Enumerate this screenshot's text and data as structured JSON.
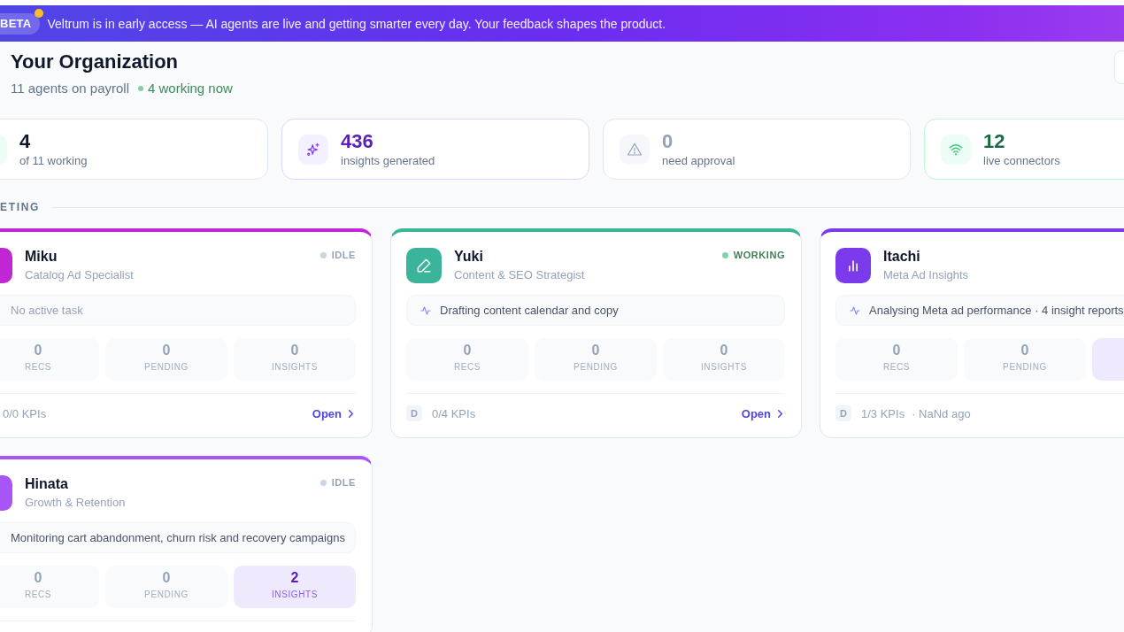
{
  "banner": {
    "badge": "BETA",
    "message": "Veltrum is in early access — AI agents are live and getting smarter every day. Your feedback shapes the product."
  },
  "header": {
    "title": "Your Organization",
    "agent_count": "11 agents on payroll",
    "working_now": "4 working now"
  },
  "stats": [
    {
      "kind": "working",
      "value": "4",
      "label": "of 11 working"
    },
    {
      "kind": "insights",
      "value": "436",
      "label": "insights generated"
    },
    {
      "kind": "approval",
      "value": "0",
      "label": "need approval"
    },
    {
      "kind": "connectors",
      "value": "12",
      "label": "live connectors"
    }
  ],
  "section": {
    "title": "ETING",
    "agents": [
      {
        "name": "Miku",
        "role": "Catalog Ad Specialist",
        "color": "#c026d3",
        "avatar": {
          "kind": "blank"
        },
        "status": {
          "label": "IDLE",
          "working": false
        },
        "task": {
          "kind": "empty",
          "text": "No active task"
        },
        "metrics": [
          {
            "value": "0",
            "label": "RECS",
            "highlighted": false
          },
          {
            "value": "0",
            "label": "PENDING",
            "highlighted": false
          },
          {
            "value": "0",
            "label": "INSIGHTS",
            "highlighted": false
          }
        ],
        "footer": {
          "kpis": "0/0 KPIs",
          "open": "Open"
        }
      },
      {
        "name": "Yuki",
        "role": "Content & SEO Strategist",
        "color": "#3bb49c",
        "avatar": {
          "kind": "pencil"
        },
        "status": {
          "label": "WORKING",
          "working": true
        },
        "task": {
          "kind": "activity",
          "text": "Drafting content calendar and copy"
        },
        "metrics": [
          {
            "value": "0",
            "label": "RECS",
            "highlighted": false
          },
          {
            "value": "0",
            "label": "PENDING",
            "highlighted": false
          },
          {
            "value": "0",
            "label": "INSIGHTS",
            "highlighted": false
          }
        ],
        "footer": {
          "initial": "D",
          "kpis": "0/4 KPIs",
          "open": "Open"
        }
      },
      {
        "name": "Itachi",
        "role": "Meta Ad Insights",
        "color": "#7c3aed",
        "avatar": {
          "kind": "bars"
        },
        "task": {
          "kind": "activity",
          "text": "Analysing Meta ad performance · 4 insight reports"
        },
        "metrics": [
          {
            "value": "0",
            "label": "RECS",
            "highlighted": false
          },
          {
            "value": "0",
            "label": "PENDING",
            "highlighted": false
          },
          {
            "highlighted": true
          }
        ],
        "footer": {
          "initial": "D",
          "kpis": "1/3 KPIs",
          "updated": "· NaNd ago"
        }
      },
      {
        "name": "Hinata",
        "role": "Growth & Retention",
        "color": "#a855f7",
        "avatar": {
          "kind": "blank"
        },
        "status": {
          "label": "IDLE",
          "working": false
        },
        "task": {
          "kind": "note",
          "text": "Monitoring cart abandonment, churn risk and recovery campaigns"
        },
        "metrics": [
          {
            "value": "0",
            "label": "RECS",
            "highlighted": false
          },
          {
            "value": "0",
            "label": "PENDING",
            "highlighted": false
          },
          {
            "value": "2",
            "label": "INSIGHTS",
            "highlighted": true
          }
        ]
      }
    ]
  }
}
